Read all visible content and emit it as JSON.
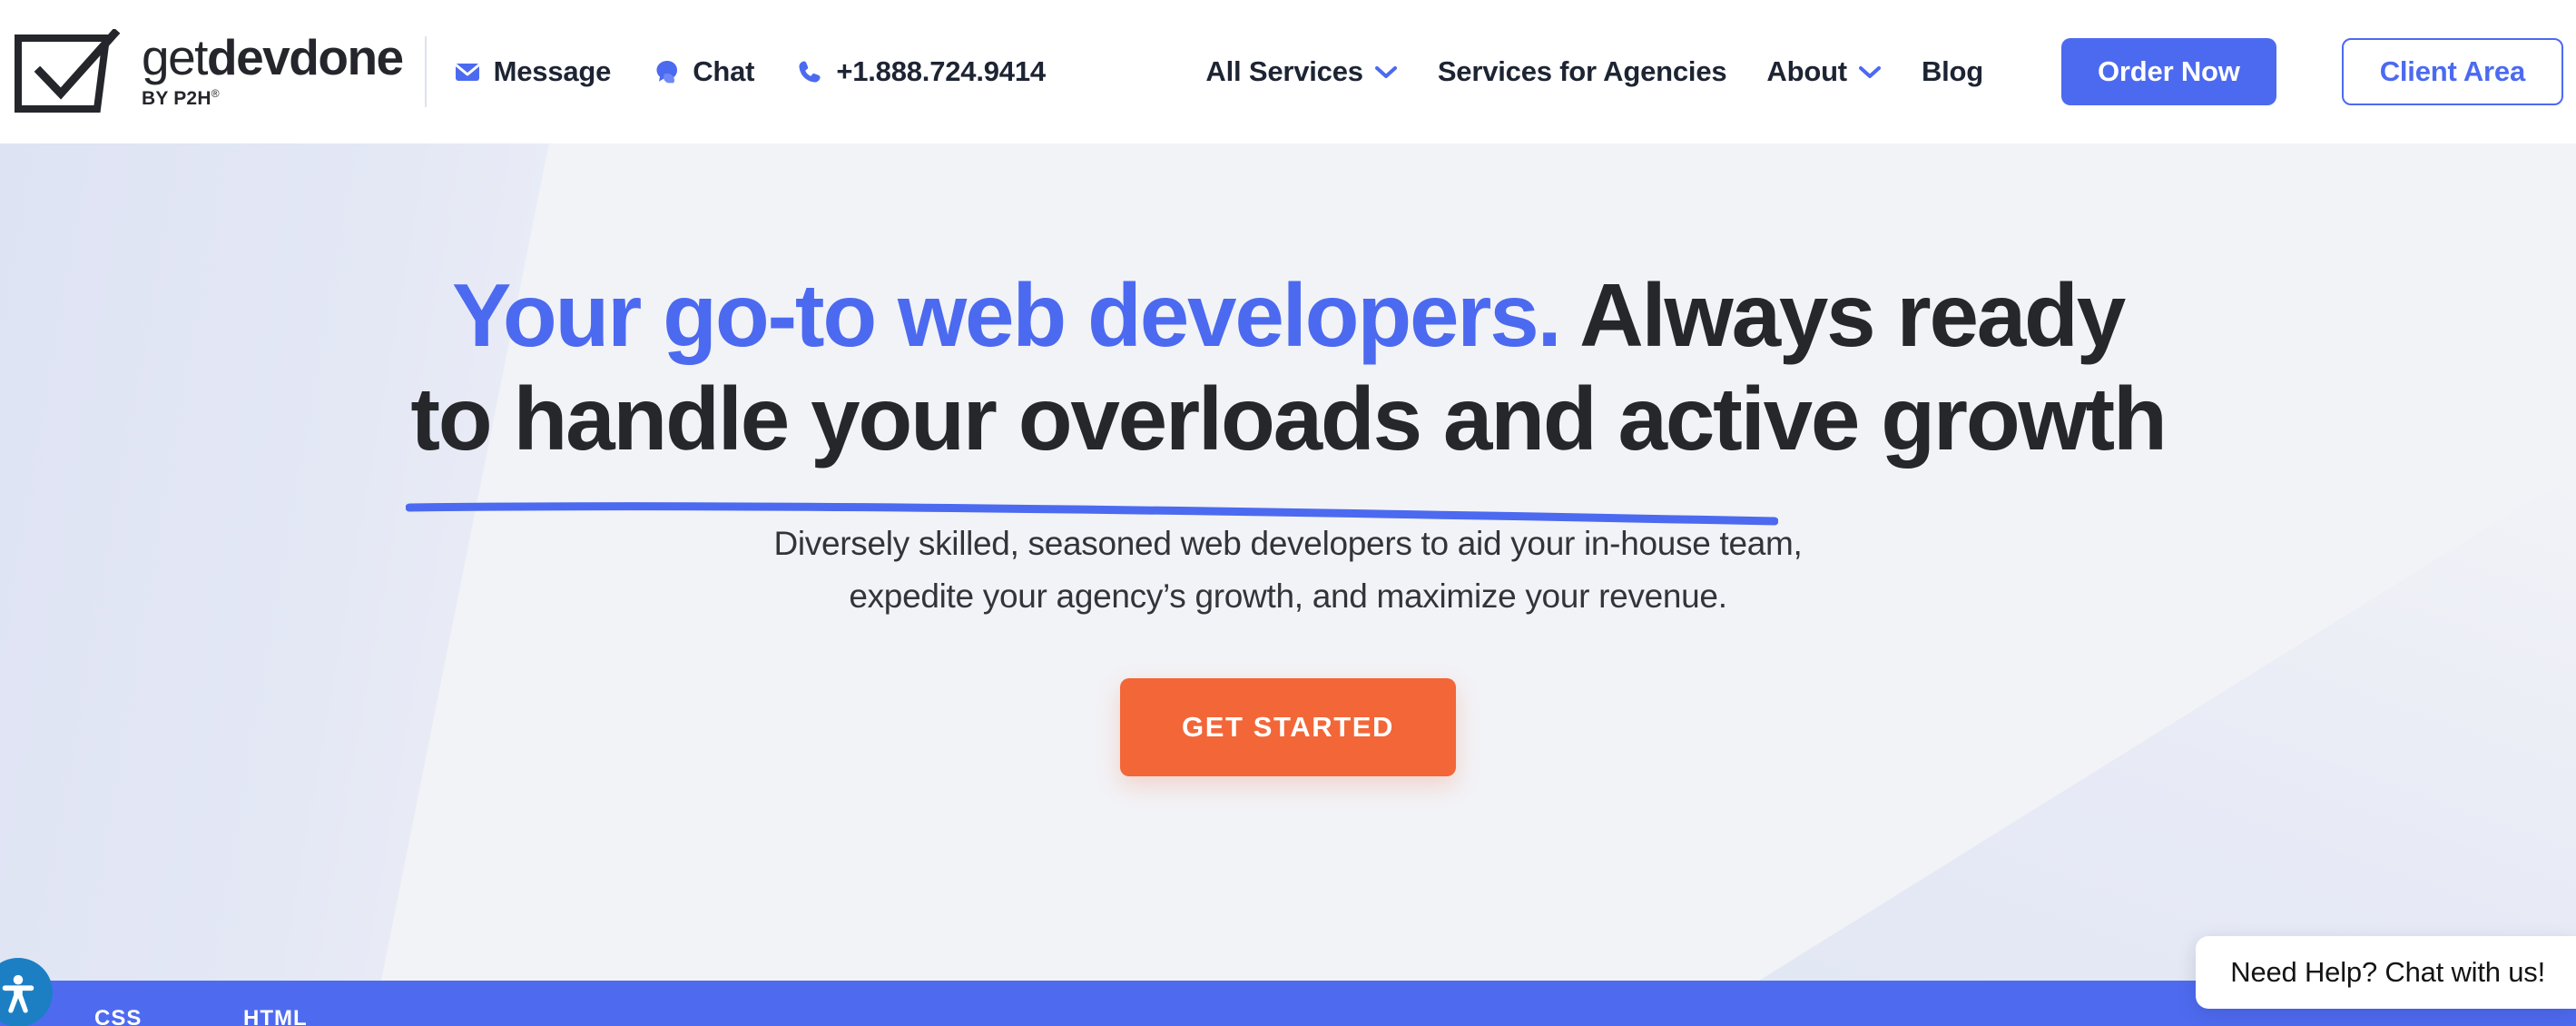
{
  "brand": {
    "logo_icon": "checkbox-check-icon",
    "name_part_1": "get",
    "name_part_2": "dev",
    "name_part_3": "done",
    "tagline": "BY P2H",
    "registered_mark": "®",
    "accent_blue": "#4C6AF0",
    "accent_orange": "#F36638",
    "text_dark": "#26272B"
  },
  "header": {
    "contacts": [
      {
        "icon": "envelope-icon",
        "label": "Message"
      },
      {
        "icon": "chat-bubble-icon",
        "label": "Chat"
      },
      {
        "icon": "phone-icon",
        "label": "+1.888.724.9414"
      }
    ],
    "nav": [
      {
        "label": "All Services",
        "has_dropdown": true,
        "icon": "chevron-down-icon"
      },
      {
        "label": "Services for Agencies",
        "has_dropdown": false
      },
      {
        "label": "About",
        "has_dropdown": true,
        "icon": "chevron-down-icon"
      },
      {
        "label": "Blog",
        "has_dropdown": false
      }
    ],
    "order_button": "Order Now",
    "client_button": "Client Area"
  },
  "hero": {
    "headline_highlight": "Your go-to web developers.",
    "headline_rest": " Always ready",
    "headline_line2": "to handle your overloads and active growth",
    "subtitle_line1": "Diversely skilled, seasoned web developers to aid your in-house team,",
    "subtitle_line2": "expedite your agency’s growth, and maximize your revenue.",
    "cta_label": "GET STARTED"
  },
  "bottom_strip": {
    "tags": [
      "CSS",
      "HTML"
    ],
    "color": "#4E6BF0"
  },
  "widgets": {
    "accessibility_icon": "accessibility-person-icon",
    "chat_prompt": "Need Help? Chat with us!"
  }
}
